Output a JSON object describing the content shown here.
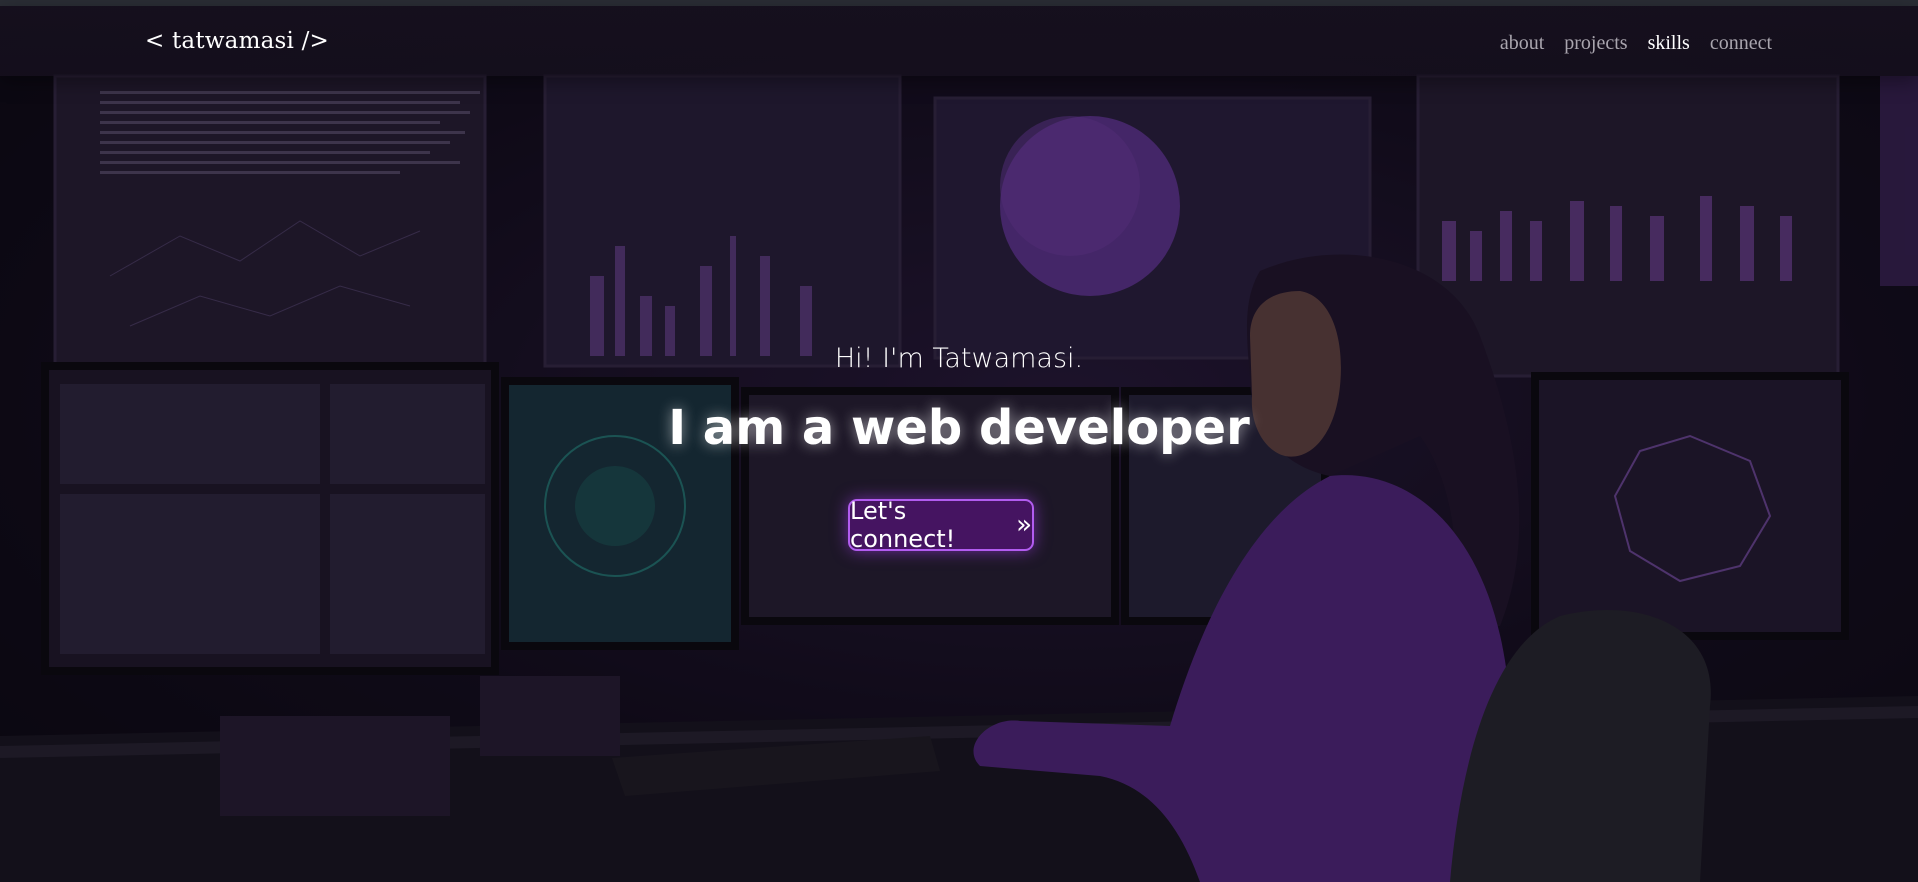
{
  "brand": {
    "logo": "< tatwamasi />"
  },
  "nav": {
    "items": [
      {
        "label": "about",
        "active": false
      },
      {
        "label": "projects",
        "active": false
      },
      {
        "label": "skills",
        "active": true
      },
      {
        "label": "connect",
        "active": false
      }
    ]
  },
  "hero": {
    "greeting": "Hi! I'm Tatwamasi.",
    "headline": "I am a web developer",
    "cta_label": "Let's connect!",
    "cta_icon": "double-chevron-right-icon"
  },
  "colors": {
    "accent": "#b25cf0",
    "background": "#140e1e",
    "nav_text": "#a9a5ae",
    "nav_active": "#ffffff"
  }
}
